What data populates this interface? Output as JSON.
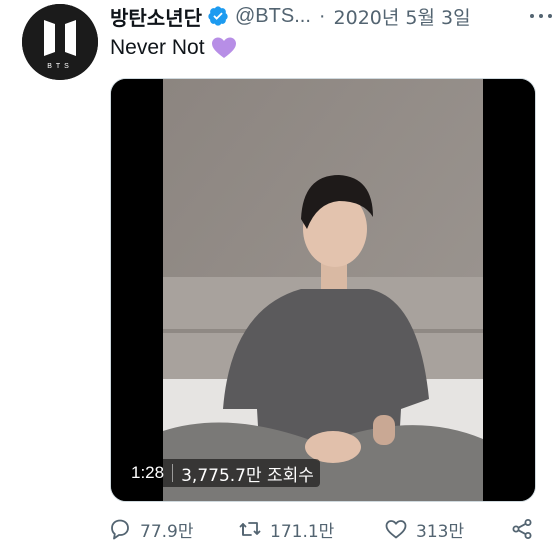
{
  "tweet": {
    "author_name": "방탄소년단",
    "handle": "@BTS...",
    "separator": "·",
    "date": "2020년 5월 3일",
    "text": "Never Not",
    "avatar_logo_text": "BTS"
  },
  "video": {
    "duration": "1:28",
    "views": "3,775.7만 조회수"
  },
  "actions": {
    "reply_count": "77.9만",
    "retweet_count": "171.1만",
    "like_count": "313만"
  },
  "colors": {
    "verified": "#1d9bf0",
    "muted_text": "#536471",
    "emoji_heart": "#b78ee6"
  }
}
